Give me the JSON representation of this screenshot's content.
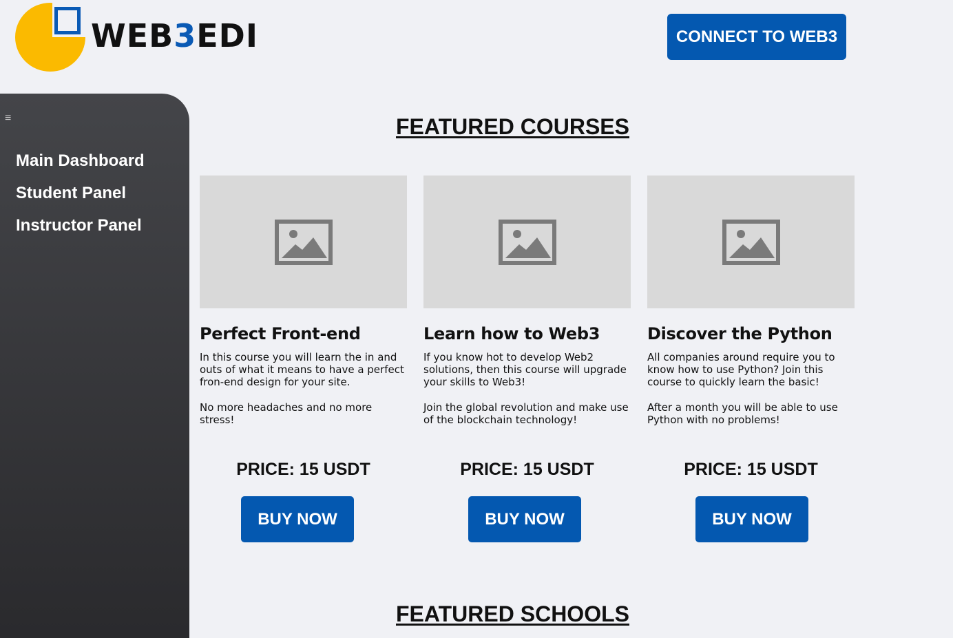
{
  "logo": {
    "text_left": "WEB",
    "text_accent": "3",
    "text_right": "EDI"
  },
  "header": {
    "connect_label": "CONNECT TO WEB3"
  },
  "sidebar": {
    "menu_icon": "≡",
    "items": [
      {
        "label": "Main Dashboard"
      },
      {
        "label": "Student Panel"
      },
      {
        "label": "Instructor Panel"
      }
    ]
  },
  "sections": {
    "courses_title": "FEATURED COURSES",
    "schools_title": "FEATURED SCHOOLS"
  },
  "courses": [
    {
      "title": "Perfect Front-end",
      "desc1": "In this course you will learn the in and outs of what it means to have a perfect fron-end design for your site.",
      "desc2": "No more headaches and no more stress!",
      "price": "PRICE: 15 USDT",
      "button": "BUY NOW"
    },
    {
      "title": "Learn how to Web3",
      "desc1": "If you know hot to develop Web2 solutions, then this course will upgrade your skills to Web3!",
      "desc2": "Join the global revolution and make use of the blockchain technology!",
      "price": "PRICE: 15 USDT",
      "button": "BUY NOW"
    },
    {
      "title": "Discover the Python",
      "desc1": "All companies around require you to know how to use Python? Join this course to quickly learn the basic!",
      "desc2": "After a month you will be able to use Python with no problems!",
      "price": "PRICE: 15 USDT",
      "button": "BUY NOW"
    }
  ],
  "colors": {
    "accent": "#0458b0",
    "logo_yellow": "#fbba00",
    "sidebar": "#3a3a3d",
    "background": "#f0f1f5"
  },
  "icons": {
    "image_placeholder": "image-placeholder-icon",
    "menu": "hamburger-menu-icon"
  }
}
